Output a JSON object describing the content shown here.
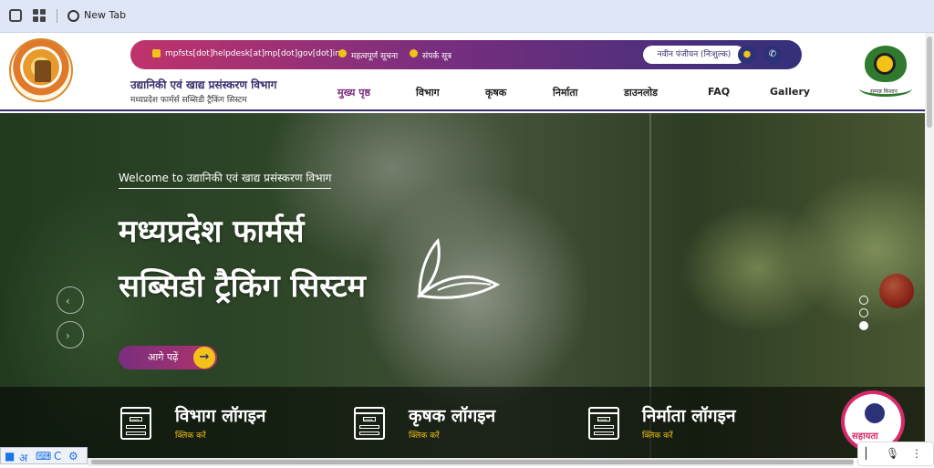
{
  "browser": {
    "tab_label": "New Tab"
  },
  "topbar": {
    "email": "mpfsts[dot]helpdesk[at]mp[dot]gov[dot]in",
    "notice": "महत्वपूर्ण सूचना",
    "contact": "संपर्क सूत्र",
    "register": "नवीन पंजीयन (निःशुल्क)"
  },
  "header": {
    "title": "उद्यानिकी एवं खाद्य प्रसंस्करण विभाग",
    "subtitle": "मध्यप्रदेश फार्मर्स सब्सिडी ट्रैकिंग सिस्टम",
    "logo_caption": "सम्पन्न किसान"
  },
  "nav": [
    {
      "label": "मुख्य पृष्ठ"
    },
    {
      "label": "विभाग"
    },
    {
      "label": "कृषक"
    },
    {
      "label": "निर्माता"
    },
    {
      "label": "डाउनलोड"
    },
    {
      "label": "FAQ"
    },
    {
      "label": "Gallery"
    }
  ],
  "hero": {
    "welcome": "Welcome to उद्यानिकी एवं खाद्य प्रसंस्करण विभाग",
    "title_line1": "मध्यप्रदेश फार्मर्स",
    "title_line2": "सब्सिडी ट्रैकिंग सिस्टम",
    "read_more": "आगे पढ़ें",
    "slides_total": 3,
    "active_slide": 3
  },
  "logins": [
    {
      "title": "विभाग लॉगइन",
      "sub": "क्लिक करें"
    },
    {
      "title": "कृषक लॉगइन",
      "sub": "क्लिक करें"
    },
    {
      "title": "निर्माता लॉगइन",
      "sub": "क्लिक करें"
    }
  ],
  "login_icon_text": "LOGIN",
  "help": {
    "label": "सहायता"
  },
  "taskbar": {
    "hindi": "अ",
    "c": "C"
  },
  "colors": {
    "brand_purple": "#3a2d6e",
    "accent_pink": "#d62a6b",
    "accent_yellow": "#f2c218"
  }
}
